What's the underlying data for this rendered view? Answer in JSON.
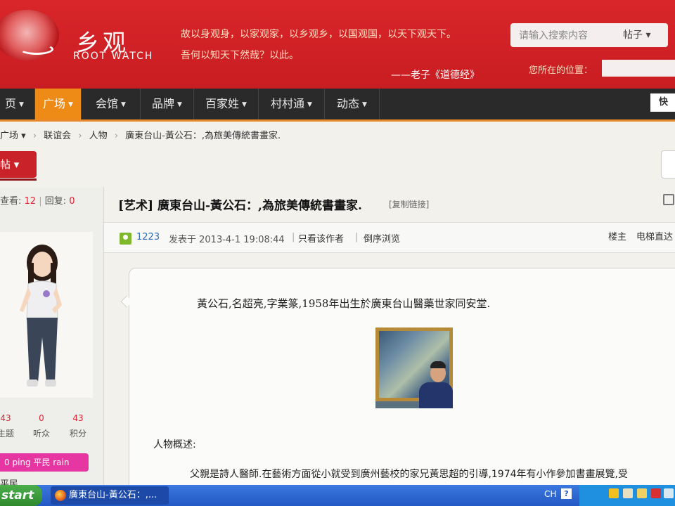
{
  "site": {
    "logo_cn": "乡观",
    "logo_en": "ROOT WATCH",
    "quote_line1": "故以身观身，以家观家，以乡观乡，以国观国，以天下观天下。",
    "quote_line2": "吾何以知天下然哉？以此。",
    "quote_source": "——老子《道德经》",
    "search_placeholder": "请输入搜索内容",
    "search_type": "帖子 ▾",
    "location_label": "您所在的位置："
  },
  "nav": {
    "items": [
      "页",
      "广场",
      "会馆",
      "品牌",
      "百家姓",
      "村村通",
      "动态"
    ],
    "active_index": 1,
    "quick": "快"
  },
  "breadcrumb": [
    "广场 ▾",
    "联谊会",
    "人物",
    "廣東台山-黃公石：,為旅美傳統書畫家."
  ],
  "post_button": "帖 ▾",
  "thread_stats": {
    "views_label": "查看:",
    "views": "12",
    "replies_label": "回复:",
    "replies": "0"
  },
  "author": {
    "stats": [
      {
        "value": "43",
        "label": "主题"
      },
      {
        "value": "0",
        "label": "听众"
      },
      {
        "value": "43",
        "label": "积分"
      }
    ],
    "badge": "0  ping 平民 rain",
    "rank": "平民"
  },
  "post": {
    "title": "[艺术] 廣東台山-黃公石：,為旅美傳統書畫家.",
    "copy_link": "[复制链接]",
    "user": "1223",
    "posted": "发表于  2013-4-1  19:08:44",
    "only_author": "只看该作者",
    "reverse": "倒序浏览",
    "floor": "楼主",
    "jump": "电梯直达",
    "para1": "黃公石,名超亮,字業篆,1958年出生於廣東台山醫藥世家同安堂.",
    "section": "人物概述:",
    "para2": "父親是詩人醫師.在藝術方面從小就受到廣州藝校的家兄黃思超的引導,1974年有小作參加書畫展覽,受"
  },
  "taskbar": {
    "start": "start",
    "task": "廣東台山-黃公石：,...",
    "lang": "CH",
    "help": "?"
  }
}
